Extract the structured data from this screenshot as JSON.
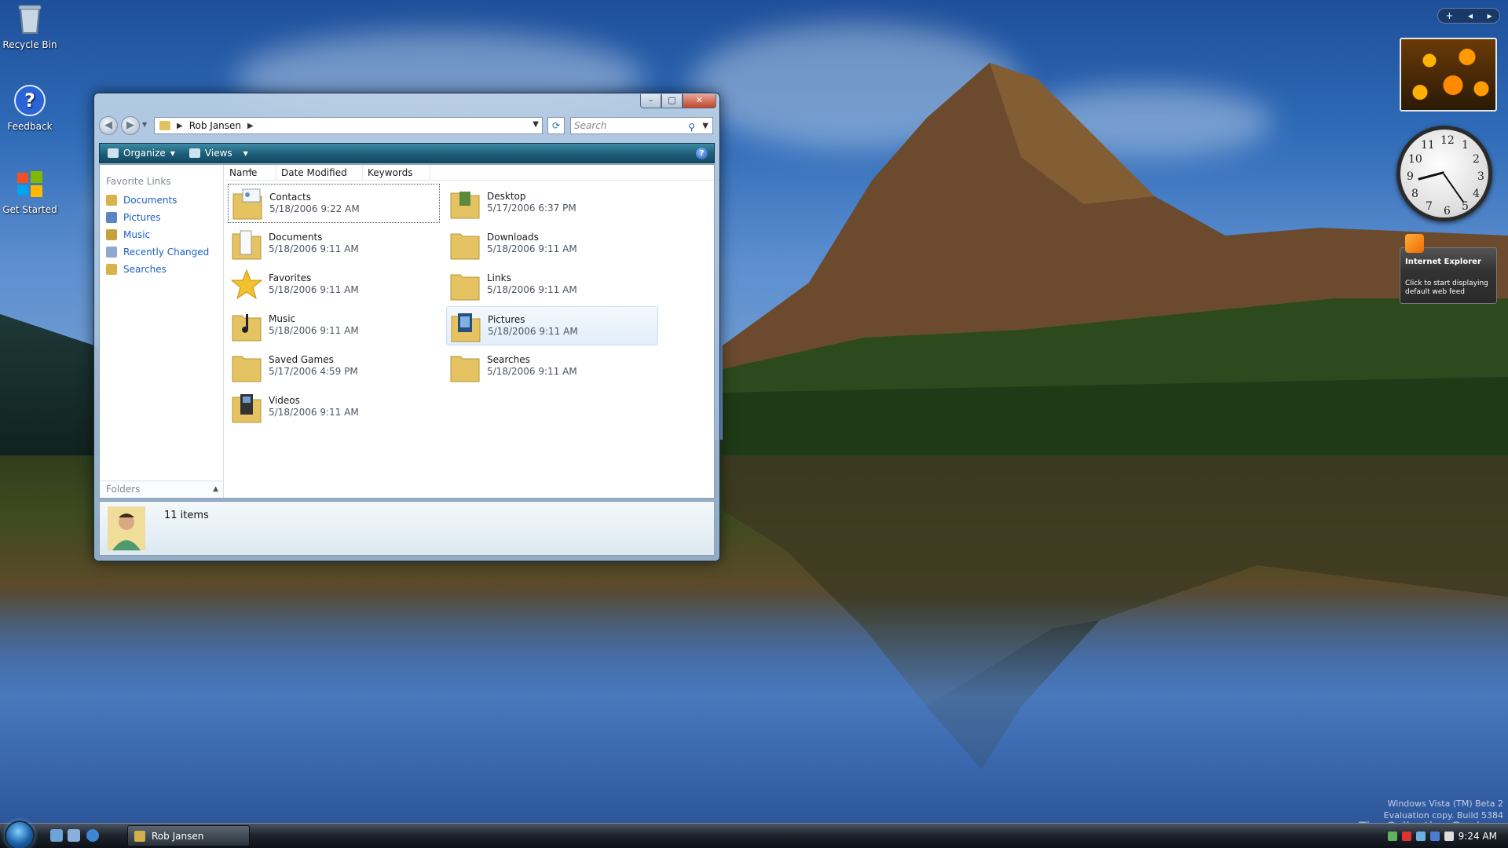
{
  "desktop": {
    "icons": [
      {
        "label": "Recycle Bin",
        "icon": "recycle-bin-icon"
      },
      {
        "label": "Feedback",
        "icon": "help-icon"
      },
      {
        "label": "Get Started",
        "icon": "windows-flag-icon"
      }
    ]
  },
  "window": {
    "address": {
      "segments": [
        "Rob Jansen"
      ]
    },
    "search_placeholder": "Search",
    "commands": {
      "organize": "Organize",
      "views": "Views"
    },
    "favorite_links": {
      "header": "Favorite Links",
      "items": [
        "Documents",
        "Pictures",
        "Music",
        "Recently Changed",
        "Searches"
      ]
    },
    "folders_label": "Folders",
    "columns": [
      "Name",
      "Date Modified",
      "Keywords"
    ],
    "items": [
      {
        "name": "Contacts",
        "date": "5/18/2006 9:22 AM"
      },
      {
        "name": "Desktop",
        "date": "5/17/2006 6:37 PM"
      },
      {
        "name": "Documents",
        "date": "5/18/2006 9:11 AM"
      },
      {
        "name": "Downloads",
        "date": "5/18/2006 9:11 AM"
      },
      {
        "name": "Favorites",
        "date": "5/18/2006 9:11 AM"
      },
      {
        "name": "Links",
        "date": "5/18/2006 9:11 AM"
      },
      {
        "name": "Music",
        "date": "5/18/2006 9:11 AM"
      },
      {
        "name": "Pictures",
        "date": "5/18/2006 9:11 AM"
      },
      {
        "name": "Saved Games",
        "date": "5/17/2006 4:59 PM"
      },
      {
        "name": "Searches",
        "date": "5/18/2006 9:11 AM"
      },
      {
        "name": "Videos",
        "date": "5/18/2006 9:11 AM"
      }
    ],
    "details": {
      "count": "11 items"
    }
  },
  "sidebar": {
    "clock_numbers": [
      "12",
      "1",
      "2",
      "3",
      "4",
      "5",
      "6",
      "7",
      "8",
      "9",
      "10",
      "11"
    ],
    "feed": {
      "title": "Internet Explorer",
      "desc": "Click to start displaying default web feed"
    }
  },
  "taskbar": {
    "window_button": "Rob Jansen",
    "time": "9:24 AM"
  },
  "watermark": {
    "line1": "Windows Vista (TM) Beta 2",
    "line2": "Evaluation copy. Build 5384",
    "collection": "The Collection Book"
  },
  "colors": {
    "link": "#1d5ec2",
    "commandbar": "#1c5d78"
  }
}
